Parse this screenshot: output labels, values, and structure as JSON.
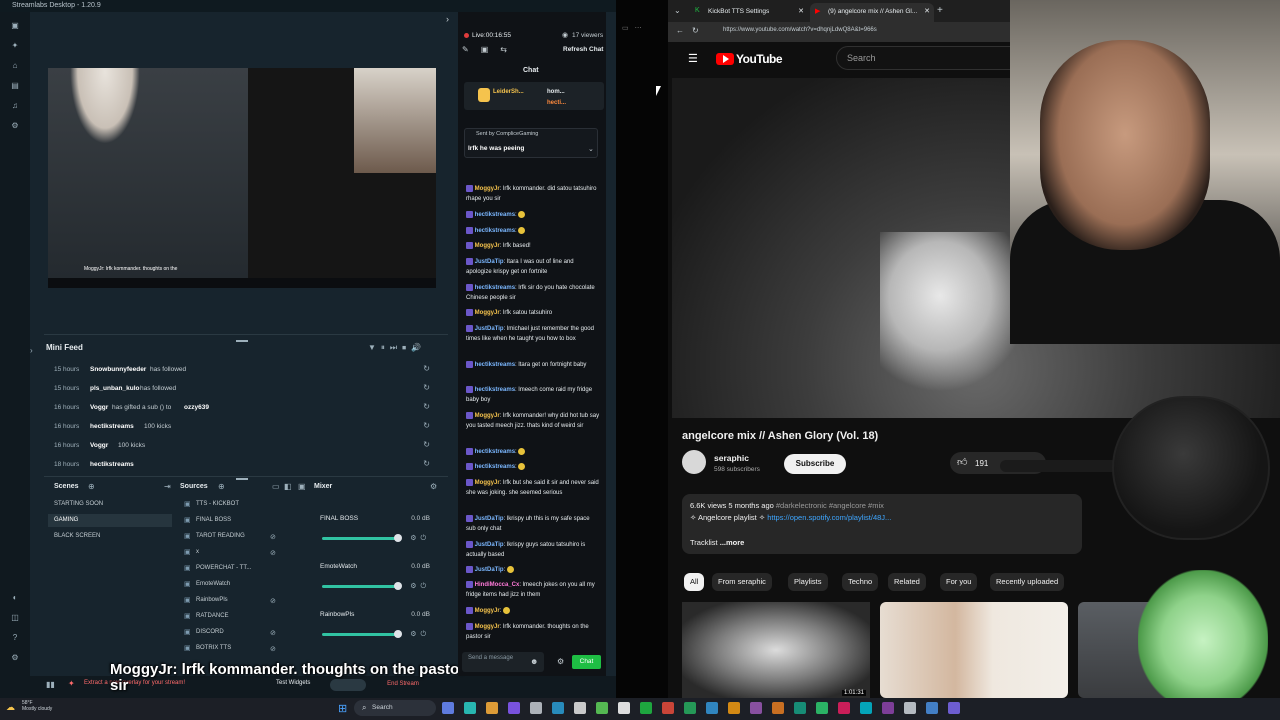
{
  "streamlabs": {
    "title": "Streamlabs Desktop - 1.20.9",
    "preview_caption": "MoggyJr: lrfk kommander. thoughts on the",
    "mini_feed": {
      "title": "Mini Feed",
      "rows": [
        {
          "time": "15 hours",
          "user": "Snowbunnyfeeder",
          "action": "has followed",
          "extra": ""
        },
        {
          "time": "15 hours",
          "user": "pls_unban_kulo",
          "action": "has followed",
          "extra": ""
        },
        {
          "time": "16 hours",
          "user": "Voggr",
          "action": "has gifted a sub () to",
          "extra": "ozzy639"
        },
        {
          "time": "16 hours",
          "user": "hectikstreams",
          "action": "100 kicks",
          "extra": ""
        },
        {
          "time": "16 hours",
          "user": "Voggr",
          "action": "100 kicks",
          "extra": ""
        },
        {
          "time": "18 hours",
          "user": "hectikstreams",
          "action": "100 kicks",
          "extra": ""
        }
      ]
    },
    "scenes": {
      "title": "Scenes",
      "items": [
        "STARTING SOON",
        "GAMING",
        "BLACK SCREEN"
      ]
    },
    "sources": {
      "title": "Sources",
      "items": [
        "TTS - KICKBOT",
        "FINAL BOSS",
        "TAROT READING",
        "x",
        "POWERCHAT - TT...",
        "EmoteWatch",
        "RainbowPls",
        "RATDANCE",
        "DISCORD",
        "BOTRIX TTS"
      ]
    },
    "mixer": {
      "title": "Mixer",
      "rows": [
        {
          "name": "FINAL BOSS",
          "db": "0.0 dB",
          "level": 1.0
        },
        {
          "name": "EmoteWatch",
          "db": "0.0 dB",
          "level": 1.0
        },
        {
          "name": "RainbowPls",
          "db": "0.0 dB",
          "level": 1.0
        }
      ]
    },
    "subtitle": "MoggyJr: lrfk kommander. thoughts on the pastor sir",
    "footer": {
      "widget_text": "Extract a new overlay for your stream!",
      "test_widgets": "Test Widgets",
      "end_stream": "End Stream"
    }
  },
  "chat": {
    "live": "Live:00:16:55",
    "viewers": "17 viewers",
    "refresh": "Refresh Chat",
    "tab": "Chat",
    "pinned": {
      "user1": "LeiderSh...",
      "user2": "hom...",
      "user3": "hecti..."
    },
    "sent_by": "Sent by CompliceGaming",
    "sent_msg": "lrfk he was peeing",
    "messages": [
      {
        "user": "MoggyJr",
        "color": "#f5c34d",
        "text": "lrfk kommander. did satou tatsuhiro rhape you sir"
      },
      {
        "user": "hectikstreams",
        "color": "#7bb7ff",
        "text": ""
      },
      {
        "user": "hectikstreams",
        "color": "#7bb7ff",
        "text": ""
      },
      {
        "user": "MoggyJr",
        "color": "#f5c34d",
        "text": "lrfk based!"
      },
      {
        "user": "JustDaTip",
        "color": "#7bb7ff",
        "text": "ltara I was out of line and apologize krispy get on fortnite"
      },
      {
        "user": "hectikstreams",
        "color": "#7bb7ff",
        "text": "lrfk sir do you hate chocolate Chinese people sir"
      },
      {
        "user": "MoggyJr",
        "color": "#f5c34d",
        "text": "lrfk satou tatsuhiro"
      },
      {
        "user": "JustDaTip",
        "color": "#7bb7ff",
        "text": "lmichael just remember the good times like when he taught you how to box"
      },
      {
        "user": "hectikstreams",
        "color": "#7bb7ff",
        "text": "ltara get on fortnight baby"
      },
      {
        "user": "hectikstreams",
        "color": "#7bb7ff",
        "text": "lmeech come raid my fridge baby boy"
      },
      {
        "user": "MoggyJr",
        "color": "#f5c34d",
        "text": "lrfk kommander! why did hot tub say you tasted meech jizz. thats kind of weird sir"
      },
      {
        "user": "hectikstreams",
        "color": "#7bb7ff",
        "text": ""
      },
      {
        "user": "hectikstreams",
        "color": "#7bb7ff",
        "text": ""
      },
      {
        "user": "MoggyJr",
        "color": "#f5c34d",
        "text": "lrfk but she said it sir and never said she was joking. she seemed serious"
      },
      {
        "user": "JustDaTip",
        "color": "#7bb7ff",
        "text": "lkrispy uh this is my safe space sub only chat"
      },
      {
        "user": "JustDaTip",
        "color": "#7bb7ff",
        "text": "lkrispy guys satou tatsuhiro is actually based"
      },
      {
        "user": "JustDaTip",
        "color": "#7bb7ff",
        "text": ""
      },
      {
        "user": "HindiMocca_Cx",
        "color": "#ff7ad9",
        "text": "lmeech jokes on you all my fridge items had jizz in them"
      },
      {
        "user": "MoggyJr",
        "color": "#f5c34d",
        "text": ""
      },
      {
        "user": "MoggyJr",
        "color": "#f5c34d",
        "text": "lrfk kommander. thoughts on the pastor sir"
      }
    ],
    "input_placeholder": "Send a message",
    "send_label": "Chat"
  },
  "browser": {
    "tabs": [
      "KickBot TTS Settings",
      "(9) angelcore mix // Ashen Gl..."
    ],
    "url": "https://www.youtube.com/watch?v=dhqnjLdwQ8A&t=966s",
    "search_placeholder": "Search",
    "logo": "YouTube"
  },
  "youtube": {
    "video_title": "angelcore mix // Ashen Glory (Vol. 18)",
    "channel": "seraphic",
    "subscribers": "598 subscribers",
    "subscribe_label": "Subscribe",
    "likes": "191",
    "views_time": "6.6K views  5 months ago",
    "hashtags": "#darkelectronic #angelcore #mix",
    "playlist_label": "✧ Angelcore playlist ✧",
    "playlist_link": "https://open.spotify.com/playlist/48J...",
    "tracklist": "Tracklist",
    "more": "...more",
    "chips": [
      "All",
      "From seraphic",
      "Playlists",
      "Techno",
      "Related",
      "For you",
      "Recently uploaded"
    ],
    "thumb_duration": "1:01:31"
  },
  "taskbar": {
    "weather_temp": "58°F",
    "weather_desc": "Mostly cloudy",
    "search": "Search"
  },
  "colors": {
    "streamlabs_bg": "#17242d",
    "accent_green": "#1ebe44",
    "youtube_red": "#ff0000",
    "link_blue": "#3ea6ff"
  }
}
